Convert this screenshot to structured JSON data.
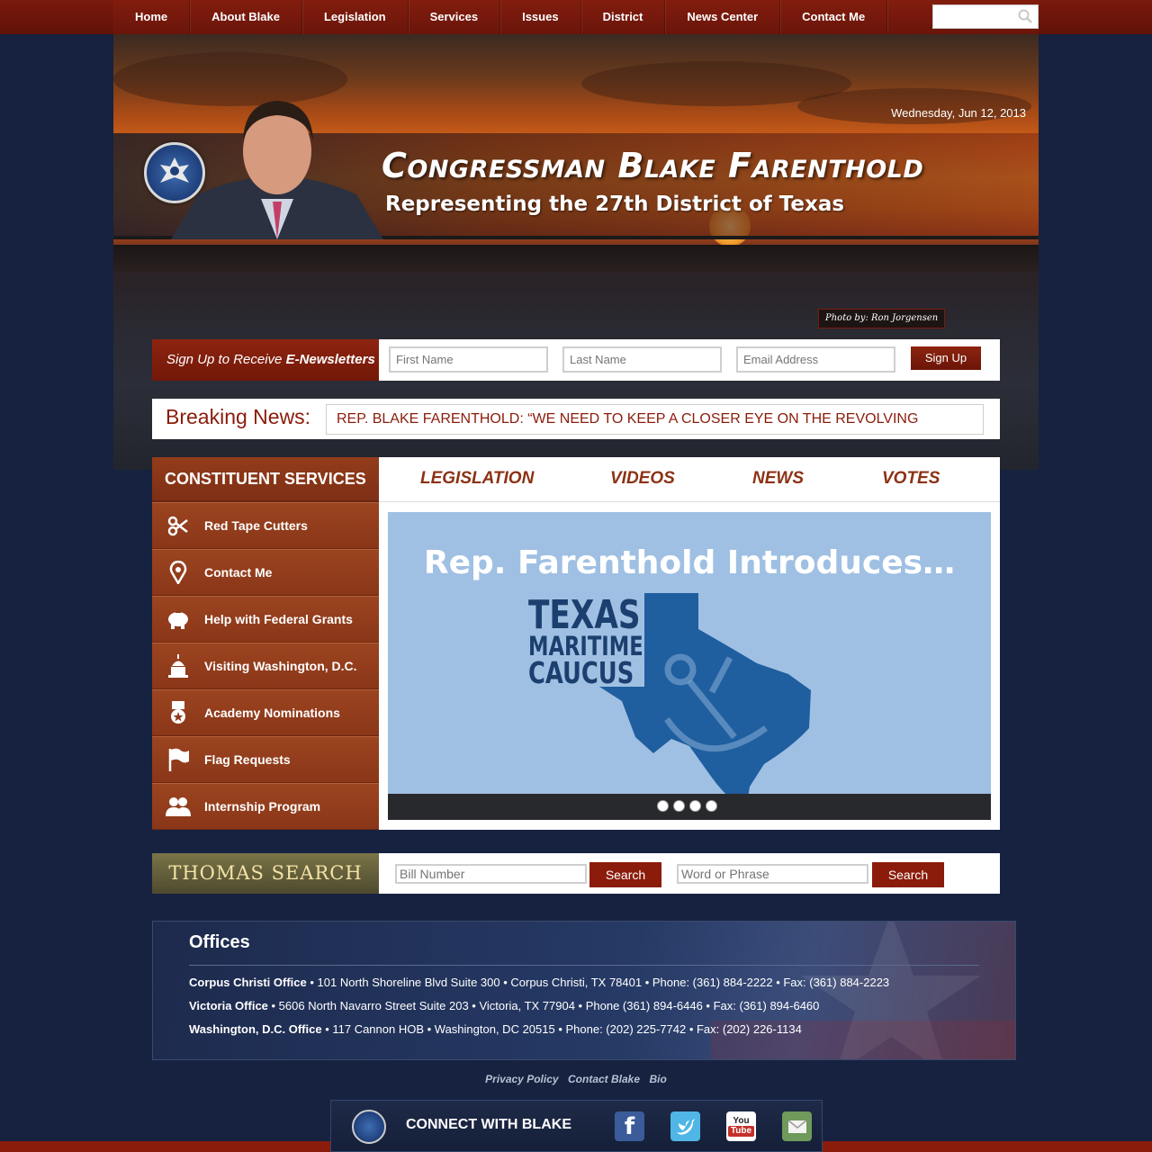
{
  "nav": {
    "items": [
      "Home",
      "About Blake",
      "Legislation",
      "Services",
      "Issues",
      "District",
      "News Center",
      "Contact Me"
    ],
    "search_placeholder": ""
  },
  "header": {
    "date": "Wednesday, Jun 12, 2013",
    "title": "Congressman Blake Farenthold",
    "subtitle": "Representing the 27th District of Texas",
    "photo_credit": "Photo by: Ron Jorgensen"
  },
  "newsletter": {
    "label_prefix": "Sign Up to Receive ",
    "label_bold": "E-Newsletters",
    "first_name_placeholder": "First Name",
    "last_name_placeholder": "Last Name",
    "email_placeholder": "Email Address",
    "button": "Sign Up"
  },
  "breaking": {
    "label": "Breaking News:",
    "headline": "REP. BLAKE FARENTHOLD: “WE NEED TO KEEP A CLOSER EYE ON THE REVOLVING"
  },
  "services": {
    "heading": "CONSTITUENT SERVICES",
    "items": [
      {
        "label": "Red Tape Cutters",
        "icon": "scissors-icon"
      },
      {
        "label": "Contact Me",
        "icon": "map-pin-icon"
      },
      {
        "label": "Help with Federal Grants",
        "icon": "piggy-bank-icon"
      },
      {
        "label": "Visiting Washington, D.C.",
        "icon": "capitol-icon"
      },
      {
        "label": "Academy Nominations",
        "icon": "medal-icon"
      },
      {
        "label": "Flag Requests",
        "icon": "flag-icon"
      },
      {
        "label": "Internship Program",
        "icon": "people-icon"
      }
    ]
  },
  "feature": {
    "tabs": [
      "LEGISLATION",
      "VIDEOS",
      "NEWS",
      "VOTES"
    ],
    "slide_title": "Rep. Farenthold Introduces…",
    "slide_caption_lines": [
      "TEXAS",
      "MARITIME",
      "CAUCUS"
    ],
    "slide_count": 4
  },
  "thomas": {
    "logo": "THOMAS SEARCH",
    "bill_placeholder": "Bill Number",
    "phrase_placeholder": "Word or Phrase",
    "button": "Search"
  },
  "offices": {
    "heading": "Offices",
    "rows": [
      {
        "name": "Corpus Christi Office",
        "details": " • 101 North Shoreline Blvd Suite 300 • Corpus Christi, TX 78401 • Phone: (361) 884-2222 • Fax: (361) 884-2223"
      },
      {
        "name": "Victoria Office",
        "details": " • 5606 North Navarro Street Suite 203 • Victoria, TX 77904 • Phone (361) 894-6446 • Fax: (361) 894-6460"
      },
      {
        "name": "Washington, D.C. Office",
        "details": " • 117 Cannon HOB • Washington, DC 20515 • Phone: (202) 225-7742 • Fax: (202) 226-1134"
      }
    ]
  },
  "footer": {
    "links": [
      "Privacy Policy",
      "Contact Blake",
      "Bio"
    ]
  },
  "connect": {
    "label": "CONNECT WITH BLAKE",
    "networks": [
      "facebook-icon",
      "twitter-icon",
      "youtube-icon",
      "email-icon"
    ],
    "youtube_text": "You Tube"
  },
  "colors": {
    "nav_red": "#7a1a0c",
    "accent_red": "#8b1c0b",
    "services_brown": "#8e3a1c",
    "page_navy": "#16223f",
    "tab_text": "#8b3215",
    "slide_blue": "#9fc0e3"
  }
}
